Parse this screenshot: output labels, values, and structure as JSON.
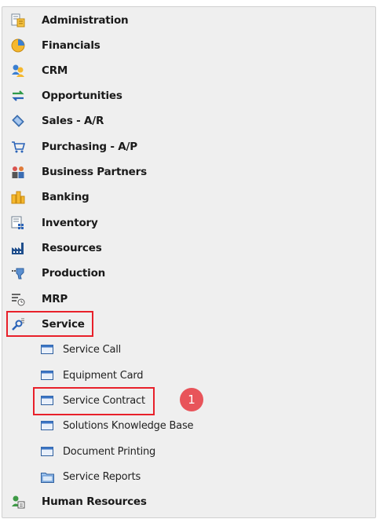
{
  "menu": {
    "items": [
      {
        "label": "Administration",
        "icon": "administration-icon"
      },
      {
        "label": "Financials",
        "icon": "financials-icon"
      },
      {
        "label": "CRM",
        "icon": "crm-icon"
      },
      {
        "label": "Opportunities",
        "icon": "opportunities-icon"
      },
      {
        "label": "Sales - A/R",
        "icon": "sales-icon"
      },
      {
        "label": "Purchasing - A/P",
        "icon": "purchasing-cart-icon"
      },
      {
        "label": "Business Partners",
        "icon": "business-partners-icon"
      },
      {
        "label": "Banking",
        "icon": "banking-icon"
      },
      {
        "label": "Inventory",
        "icon": "inventory-icon"
      },
      {
        "label": "Resources",
        "icon": "resources-icon"
      },
      {
        "label": "Production",
        "icon": "production-icon"
      },
      {
        "label": "MRP",
        "icon": "mrp-icon"
      },
      {
        "label": "Service",
        "icon": "service-icon",
        "expanded": true
      },
      {
        "label": "Human Resources",
        "icon": "human-resources-icon"
      }
    ],
    "service_children": [
      {
        "label": "Service Call",
        "icon": "form-window-icon"
      },
      {
        "label": "Equipment Card",
        "icon": "form-window-icon"
      },
      {
        "label": "Service Contract",
        "icon": "form-window-icon",
        "highlighted": true
      },
      {
        "label": "Solutions Knowledge Base",
        "icon": "form-window-icon"
      },
      {
        "label": "Document Printing",
        "icon": "form-window-icon"
      },
      {
        "label": "Service Reports",
        "icon": "folder-icon"
      }
    ]
  },
  "annotation": {
    "step_number": "1",
    "color": "#e8545a"
  },
  "highlight_color": "#e8202a"
}
